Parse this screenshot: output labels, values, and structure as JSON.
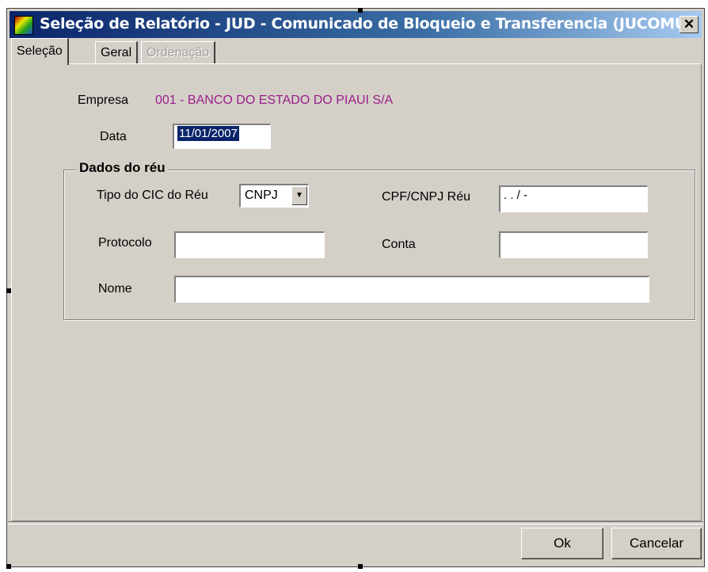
{
  "window": {
    "title": "Seleção de Relatório - JUD - Comunicado de Bloqueio e Transferencia (JUCOMU)",
    "close_label": "✕"
  },
  "tabs": [
    {
      "label": "Seleção",
      "state": "active"
    },
    {
      "label": "Geral",
      "state": "normal"
    },
    {
      "label": "Ordenação",
      "state": "disabled"
    }
  ],
  "form": {
    "empresa_label": "Empresa",
    "empresa_value": "001 - BANCO DO ESTADO DO PIAUI S/A",
    "data_label": "Data",
    "data_value": "11/01/2007"
  },
  "group": {
    "title": "Dados do réu",
    "tipo_cic_label": "Tipo do CIC do Réu",
    "tipo_cic_value": "CNPJ",
    "cpf_cnpj_label": "CPF/CNPJ Réu",
    "cpf_cnpj_value": ". . /  -",
    "protocolo_label": "Protocolo",
    "protocolo_value": "",
    "conta_label": "Conta",
    "conta_value": "",
    "nome_label": "Nome",
    "nome_value": ""
  },
  "buttons": {
    "ok_label": "Ok",
    "cancel_label": "Cancelar"
  },
  "colors": {
    "titlebar_start": "#0a246a",
    "titlebar_end": "#a6caf0",
    "empresa_value": "#9b1d8c",
    "face": "#d4d0c8"
  }
}
